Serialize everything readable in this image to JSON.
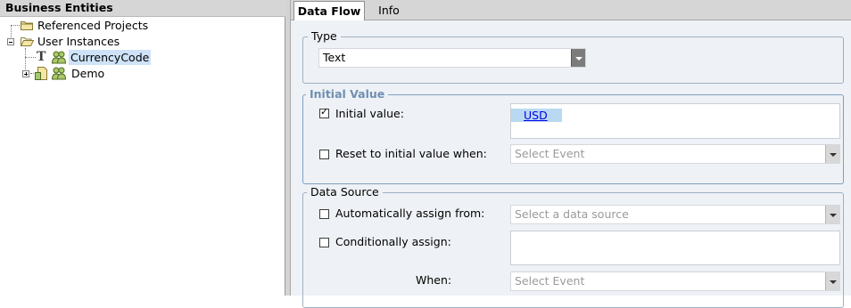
{
  "tree": {
    "title": "Business Entities",
    "nodes": [
      {
        "label": "Referenced Projects",
        "icon": "folder-icon"
      },
      {
        "label": "User Instances",
        "icon": "folder-open-icon"
      },
      {
        "label": "CurrencyCode",
        "icon": "text-type-icon",
        "selected": true
      },
      {
        "label": "Demo",
        "icon": "document-icon"
      }
    ]
  },
  "tabs": [
    {
      "label": "Data Flow",
      "active": true
    },
    {
      "label": "Info",
      "active": false
    }
  ],
  "type_section": {
    "legend": "Type",
    "value": "Text"
  },
  "initial_value_section": {
    "legend": "Initial Value",
    "initial_value_label": "Initial value:",
    "initial_value_checked": true,
    "initial_value_token": "USD",
    "reset_label": "Reset to initial value when:",
    "reset_checked": false,
    "reset_placeholder": "Select Event"
  },
  "data_source_section": {
    "legend": "Data Source",
    "auto_label": "Automatically assign from:",
    "auto_checked": false,
    "auto_placeholder": "Select a data source",
    "cond_label": "Conditionally assign:",
    "cond_checked": false,
    "when_label": "When:",
    "when_placeholder": "Select Event"
  },
  "colors": {
    "accent": "#6f8fb0",
    "selection": "#cfe3f8",
    "panel_bg": "#eef1f5"
  }
}
